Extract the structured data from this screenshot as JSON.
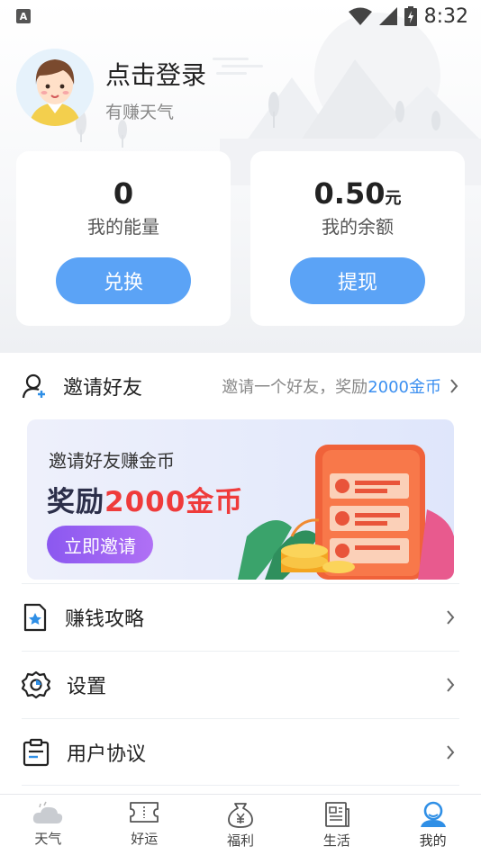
{
  "status": {
    "a_icon_letter": "A",
    "time": "8:32"
  },
  "profile": {
    "name": "点击登录",
    "subtitle": "有赚天气"
  },
  "cards": [
    {
      "value": "0",
      "unit": "",
      "label": "我的能量",
      "button": "兑换"
    },
    {
      "value": "0.50",
      "unit": "元",
      "label": "我的余额",
      "button": "提现"
    }
  ],
  "invite": {
    "title": "邀请一个好友，奖励",
    "title_main": "邀请好友",
    "desc_prefix": "邀请一个好友，奖励",
    "desc_highlight": "2000金币"
  },
  "banner": {
    "subtitle": "邀请好友赚金币",
    "title_prefix": "奖励",
    "title_highlight": "2000金币",
    "button": "立即邀请"
  },
  "menu": [
    {
      "label": "赚钱攻略",
      "icon": "guide-star-icon"
    },
    {
      "label": "设置",
      "icon": "gear-icon"
    },
    {
      "label": "用户协议",
      "icon": "clipboard-icon"
    }
  ],
  "tabs": [
    {
      "label": "天气",
      "icon": "cloud-icon"
    },
    {
      "label": "好运",
      "icon": "ticket-icon"
    },
    {
      "label": "福利",
      "icon": "money-bag-icon"
    },
    {
      "label": "生活",
      "icon": "newspaper-icon"
    },
    {
      "label": "我的",
      "icon": "user-icon",
      "active": true
    }
  ],
  "colors": {
    "accent": "#5ba3f6",
    "highlight": "#3b8ff0",
    "banner_red": "#ef3b3b",
    "active_tab": "#2f8fe6"
  }
}
